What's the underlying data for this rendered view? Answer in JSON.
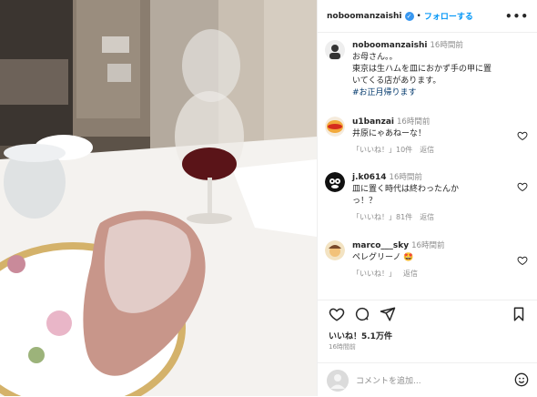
{
  "post": {
    "username": "noboomanzaishi",
    "follow_label": "フォローする",
    "more_label": "•••",
    "caption_time": "16時間前",
    "caption_lines": [
      "お母さん。。",
      "東京は生ハムを皿におかず手の甲に置",
      "いてくる店があります。"
    ],
    "hashtag": "#お正月帰ります"
  },
  "comments": [
    {
      "user": "u1banzai",
      "time": "16時間前",
      "text": "井原にゃあねーな！",
      "like_label": "「いいね！」10件",
      "reply_label": "返信"
    },
    {
      "user": "j.k0614",
      "time": "16時間前",
      "text_lines": [
        "皿に置く時代は終わったんか",
        "っ！？"
      ],
      "like_label": "「いいね！」81件",
      "reply_label": "返信"
    },
    {
      "user": "marco___sky",
      "time": "16時間前",
      "text": "ペレグリーノ 🤩",
      "like_label": "「いいね！」",
      "reply_label": "返信"
    }
  ],
  "likes": "いいね！5.1万件",
  "ago": "16時間前",
  "comment_placeholder": "コメントを追加...",
  "colors": {
    "follow": "#0095f6",
    "meta": "#8e8e8e",
    "hashtag": "#00376b",
    "verified": "#3897f0"
  }
}
